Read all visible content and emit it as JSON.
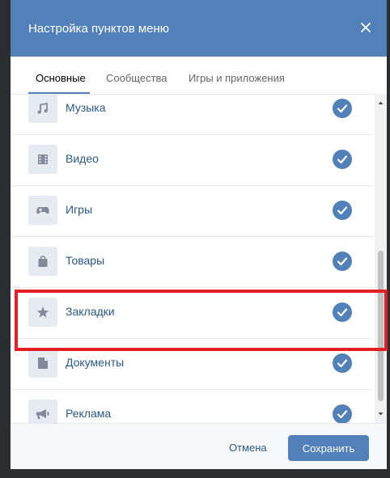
{
  "modal": {
    "title": "Настройка пунктов меню",
    "close_icon": "close-icon"
  },
  "tabs": [
    {
      "label": "Основные",
      "active": true
    },
    {
      "label": "Сообщества",
      "active": false
    },
    {
      "label": "Игры и приложения",
      "active": false
    }
  ],
  "items": [
    {
      "label": "Музыка",
      "icon": "music-icon",
      "checked": true
    },
    {
      "label": "Видео",
      "icon": "video-icon",
      "checked": true
    },
    {
      "label": "Игры",
      "icon": "gamepad-icon",
      "checked": true
    },
    {
      "label": "Товары",
      "icon": "shopping-bag-icon",
      "checked": true
    },
    {
      "label": "Закладки",
      "icon": "star-icon",
      "checked": true,
      "highlighted": true
    },
    {
      "label": "Документы",
      "icon": "document-icon",
      "checked": true
    },
    {
      "label": "Реклама",
      "icon": "megaphone-icon",
      "checked": true
    }
  ],
  "footer": {
    "cancel_label": "Отмена",
    "save_label": "Сохранить"
  },
  "colors": {
    "accent": "#5181b8",
    "link": "#2a5885",
    "icon_bg": "#e5ebf1",
    "highlight": "#e31e24"
  }
}
